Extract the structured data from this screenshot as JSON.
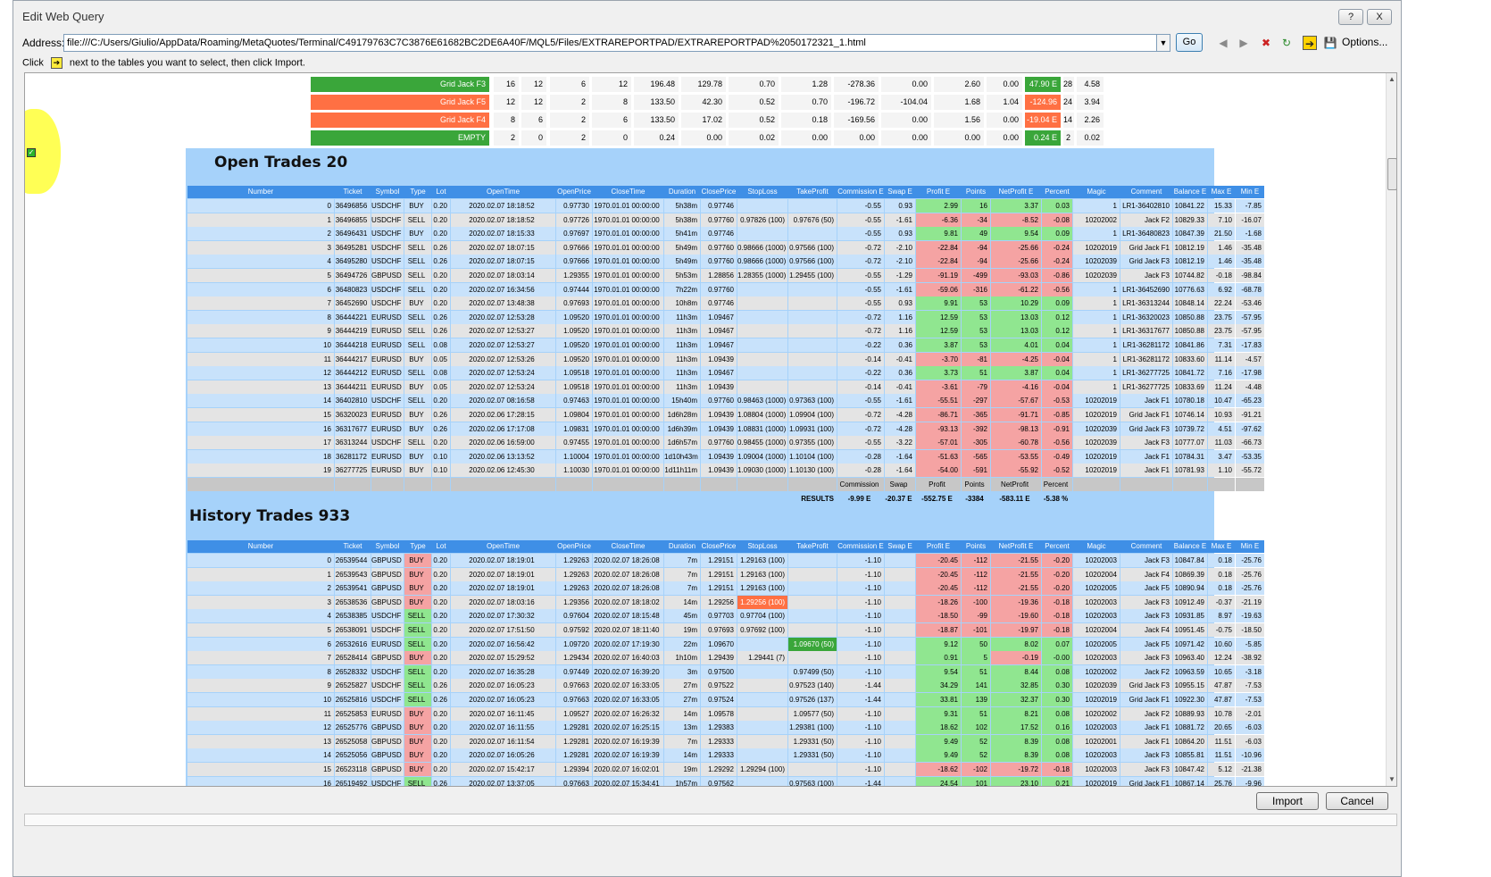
{
  "window": {
    "title": "Edit Web Query",
    "help": "?",
    "close": "X"
  },
  "address": {
    "label": "Address:",
    "value": "file:///C:/Users/Giulio/AppData/Roaming/MetaQuotes/Terminal/C49179763C7C3876E61682BC2DE6A40F/MQL5/Files/EXTRAREPORTPAD/EXTRAREPORTPAD%2050172321_1.html",
    "go": "Go",
    "options": "Options..."
  },
  "hint": {
    "prefix": "Click",
    "suffix": "next to the tables you want to select, then click Import."
  },
  "grid_panel": [
    {
      "name": "Grid Jack F3",
      "color": "#3aa63a",
      "vals": [
        "16",
        "12",
        "6",
        "12",
        "196.48",
        "129.78",
        "0.70",
        "1.28",
        "-278.36",
        "0.00",
        "2.60",
        "0.00",
        "47.90 E",
        "28",
        "4.58"
      ],
      "hl": "g"
    },
    {
      "name": "Grid Jack F5",
      "color": "#ff7043",
      "vals": [
        "12",
        "12",
        "2",
        "8",
        "133.50",
        "42.30",
        "0.52",
        "0.70",
        "-196.72",
        "-104.04",
        "1.68",
        "1.04",
        "-124.96 E",
        "24",
        "3.94"
      ],
      "hl": "r"
    },
    {
      "name": "Grid Jack F4",
      "color": "#ff7043",
      "vals": [
        "8",
        "6",
        "2",
        "6",
        "133.50",
        "17.02",
        "0.52",
        "0.18",
        "-169.56",
        "0.00",
        "1.56",
        "0.00",
        "-19.04 E",
        "14",
        "2.26"
      ],
      "hl": "r"
    },
    {
      "name": "EMPTY",
      "color": "#3aa63a",
      "vals": [
        "2",
        "0",
        "2",
        "0",
        "0.24",
        "0.00",
        "0.02",
        "0.00",
        "0.00",
        "0.00",
        "0.00",
        "0.00",
        "0.24 E",
        "2",
        "0.02"
      ],
      "hl": "g"
    }
  ],
  "open_trades": {
    "title": "Open Trades 20",
    "headers": [
      "Number",
      "Ticket",
      "Symbol",
      "Type",
      "Lot",
      "OpenTime",
      "OpenPrice",
      "CloseTime",
      "Duration",
      "ClosePrice",
      "StopLoss",
      "TakeProfit",
      "Commission E",
      "Swap E",
      "Profit E",
      "Points",
      "NetProfit E",
      "Percent",
      "Magic",
      "Comment",
      "Balance E",
      "Max E",
      "Min E"
    ],
    "rows": [
      [
        "0",
        "36496856",
        "USDCHF",
        "BUY",
        "0.20",
        "2020.02.07 18:18:52",
        "0.97730",
        "1970.01.01 00:00:00",
        "5h38m",
        "0.97746",
        "",
        "",
        "-0.55",
        "0.93",
        "2.99",
        "16",
        "3.37",
        "0.03",
        "1",
        "LR1-36402810",
        "10841.22",
        "15.33",
        "-7.85"
      ],
      [
        "1",
        "36496855",
        "USDCHF",
        "SELL",
        "0.20",
        "2020.02.07 18:18:52",
        "0.97726",
        "1970.01.01 00:00:00",
        "5h38m",
        "0.97760",
        "0.97826 (100)",
        "0.97676 (50)",
        "-0.55",
        "-1.61",
        "-6.36",
        "-34",
        "-8.52",
        "-0.08",
        "10202002",
        "Jack F2",
        "10829.33",
        "7.10",
        "-16.07"
      ],
      [
        "2",
        "36496431",
        "USDCHF",
        "BUY",
        "0.20",
        "2020.02.07 18:15:33",
        "0.97697",
        "1970.01.01 00:00:00",
        "5h41m",
        "0.97746",
        "",
        "",
        "-0.55",
        "0.93",
        "9.81",
        "49",
        "9.54",
        "0.09",
        "1",
        "LR1-36480823",
        "10847.39",
        "21.50",
        "-1.68"
      ],
      [
        "3",
        "36495281",
        "USDCHF",
        "SELL",
        "0.26",
        "2020.02.07 18:07:15",
        "0.97666",
        "1970.01.01 00:00:00",
        "5h49m",
        "0.97760",
        "0.98666 (1000)",
        "0.97566 (100)",
        "-0.72",
        "-2.10",
        "-22.84",
        "-94",
        "-25.66",
        "-0.24",
        "10202019",
        "Grid Jack F1",
        "10812.19",
        "1.46",
        "-35.48"
      ],
      [
        "4",
        "36495280",
        "USDCHF",
        "SELL",
        "0.26",
        "2020.02.07 18:07:15",
        "0.97666",
        "1970.01.01 00:00:00",
        "5h49m",
        "0.97760",
        "0.98666 (1000)",
        "0.97566 (100)",
        "-0.72",
        "-2.10",
        "-22.84",
        "-94",
        "-25.66",
        "-0.24",
        "10202039",
        "Grid Jack F3",
        "10812.19",
        "1.46",
        "-35.48"
      ],
      [
        "5",
        "36494726",
        "GBPUSD",
        "SELL",
        "0.20",
        "2020.02.07 18:03:14",
        "1.29355",
        "1970.01.01 00:00:00",
        "5h53m",
        "1.28856",
        "1.28355 (1000)",
        "1.29455 (100)",
        "-0.55",
        "-1.29",
        "-91.19",
        "-499",
        "-93.03",
        "-0.86",
        "10202039",
        "Jack F3",
        "10744.82",
        "-0.18",
        "-98.84"
      ],
      [
        "6",
        "36480823",
        "USDCHF",
        "SELL",
        "0.20",
        "2020.02.07 16:34:56",
        "0.97444",
        "1970.01.01 00:00:00",
        "7h22m",
        "0.97760",
        "",
        "",
        "-0.55",
        "-1.61",
        "-59.06",
        "-316",
        "-61.22",
        "-0.56",
        "1",
        "LR1-36452690",
        "10776.63",
        "6.92",
        "-68.78"
      ],
      [
        "7",
        "36452690",
        "USDCHF",
        "BUY",
        "0.20",
        "2020.02.07 13:48:38",
        "0.97693",
        "1970.01.01 00:00:00",
        "10h8m",
        "0.97746",
        "",
        "",
        "-0.55",
        "0.93",
        "9.91",
        "53",
        "10.29",
        "0.09",
        "1",
        "LR1-36313244",
        "10848.14",
        "22.24",
        "-53.46"
      ],
      [
        "8",
        "36444221",
        "EURUSD",
        "SELL",
        "0.26",
        "2020.02.07 12:53:28",
        "1.09520",
        "1970.01.01 00:00:00",
        "11h3m",
        "1.09467",
        "",
        "",
        "-0.72",
        "1.16",
        "12.59",
        "53",
        "13.03",
        "0.12",
        "1",
        "LR1-36320023",
        "10850.88",
        "23.75",
        "-57.95"
      ],
      [
        "9",
        "36444219",
        "EURUSD",
        "SELL",
        "0.26",
        "2020.02.07 12:53:27",
        "1.09520",
        "1970.01.01 00:00:00",
        "11h3m",
        "1.09467",
        "",
        "",
        "-0.72",
        "1.16",
        "12.59",
        "53",
        "13.03",
        "0.12",
        "1",
        "LR1-36317677",
        "10850.88",
        "23.75",
        "-57.95"
      ],
      [
        "10",
        "36444218",
        "EURUSD",
        "SELL",
        "0.08",
        "2020.02.07 12:53:27",
        "1.09520",
        "1970.01.01 00:00:00",
        "11h3m",
        "1.09467",
        "",
        "",
        "-0.22",
        "0.36",
        "3.87",
        "53",
        "4.01",
        "0.04",
        "1",
        "LR1-36281172",
        "10841.86",
        "7.31",
        "-17.83"
      ],
      [
        "11",
        "36444217",
        "EURUSD",
        "BUY",
        "0.05",
        "2020.02.07 12:53:26",
        "1.09520",
        "1970.01.01 00:00:00",
        "11h3m",
        "1.09439",
        "",
        "",
        "-0.14",
        "-0.41",
        "-3.70",
        "-81",
        "-4.25",
        "-0.04",
        "1",
        "LR1-36281172",
        "10833.60",
        "11.14",
        "-4.57"
      ],
      [
        "12",
        "36444212",
        "EURUSD",
        "SELL",
        "0.08",
        "2020.02.07 12:53:24",
        "1.09518",
        "1970.01.01 00:00:00",
        "11h3m",
        "1.09467",
        "",
        "",
        "-0.22",
        "0.36",
        "3.73",
        "51",
        "3.87",
        "0.04",
        "1",
        "LR1-36277725",
        "10841.72",
        "7.16",
        "-17.98"
      ],
      [
        "13",
        "36444211",
        "EURUSD",
        "BUY",
        "0.05",
        "2020.02.07 12:53:24",
        "1.09518",
        "1970.01.01 00:00:00",
        "11h3m",
        "1.09439",
        "",
        "",
        "-0.14",
        "-0.41",
        "-3.61",
        "-79",
        "-4.16",
        "-0.04",
        "1",
        "LR1-36277725",
        "10833.69",
        "11.24",
        "-4.48"
      ],
      [
        "14",
        "36402810",
        "USDCHF",
        "SELL",
        "0.20",
        "2020.02.07 08:16:58",
        "0.97463",
        "1970.01.01 00:00:00",
        "15h40m",
        "0.97760",
        "0.98463 (1000)",
        "0.97363 (100)",
        "-0.55",
        "-1.61",
        "-55.51",
        "-297",
        "-57.67",
        "-0.53",
        "10202019",
        "Jack F1",
        "10780.18",
        "10.47",
        "-65.23"
      ],
      [
        "15",
        "36320023",
        "EURUSD",
        "BUY",
        "0.26",
        "2020.02.06 17:28:15",
        "1.09804",
        "1970.01.01 00:00:00",
        "1d6h28m",
        "1.09439",
        "1.08804 (1000)",
        "1.09904 (100)",
        "-0.72",
        "-4.28",
        "-86.71",
        "-365",
        "-91.71",
        "-0.85",
        "10202019",
        "Grid Jack F1",
        "10746.14",
        "10.93",
        "-91.21"
      ],
      [
        "16",
        "36317677",
        "EURUSD",
        "BUY",
        "0.26",
        "2020.02.06 17:17:08",
        "1.09831",
        "1970.01.01 00:00:00",
        "1d6h39m",
        "1.09439",
        "1.08831 (1000)",
        "1.09931 (100)",
        "-0.72",
        "-4.28",
        "-93.13",
        "-392",
        "-98.13",
        "-0.91",
        "10202039",
        "Grid Jack F3",
        "10739.72",
        "4.51",
        "-97.62"
      ],
      [
        "17",
        "36313244",
        "USDCHF",
        "SELL",
        "0.20",
        "2020.02.06 16:59:00",
        "0.97455",
        "1970.01.01 00:00:00",
        "1d6h57m",
        "0.97760",
        "0.98455 (1000)",
        "0.97355 (100)",
        "-0.55",
        "-3.22",
        "-57.01",
        "-305",
        "-60.78",
        "-0.56",
        "10202039",
        "Jack F3",
        "10777.07",
        "11.03",
        "-66.73"
      ],
      [
        "18",
        "36281172",
        "EURUSD",
        "BUY",
        "0.10",
        "2020.02.06 13:13:52",
        "1.10004",
        "1970.01.01 00:00:00",
        "1d10h43m",
        "1.09439",
        "1.09004 (1000)",
        "1.10104 (100)",
        "-0.28",
        "-1.64",
        "-51.63",
        "-565",
        "-53.55",
        "-0.49",
        "10202019",
        "Jack F1",
        "10784.31",
        "3.47",
        "-53.35"
      ],
      [
        "19",
        "36277725",
        "EURUSD",
        "BUY",
        "0.10",
        "2020.02.06 12:45:30",
        "1.10030",
        "1970.01.01 00:00:00",
        "1d11h11m",
        "1.09439",
        "1.09030 (1000)",
        "1.10130 (100)",
        "-0.28",
        "-1.64",
        "-54.00",
        "-591",
        "-55.92",
        "-0.52",
        "10202019",
        "Jack F1",
        "10781.93",
        "1.10",
        "-55.72"
      ]
    ],
    "totals_labels": [
      "Commission",
      "Swap",
      "Profit",
      "Points",
      "NetProfit",
      "Percent"
    ],
    "results_label": "RESULTS",
    "results": [
      "-9.99 E",
      "-20.37 E",
      "-552.75 E",
      "-3384",
      "-583.11 E",
      "-5.38 %"
    ]
  },
  "history_trades": {
    "title": "History Trades 933",
    "headers": [
      "Number",
      "Ticket",
      "Symbol",
      "Type",
      "Lot",
      "OpenTime",
      "OpenPrice",
      "CloseTime",
      "Duration",
      "ClosePrice",
      "StopLoss",
      "TakeProfit",
      "Commission E",
      "Swap E",
      "Profit E",
      "Points",
      "NetProfit E",
      "Percent",
      "Magic",
      "Comment",
      "Balance E",
      "Max E",
      "Min E"
    ],
    "rows": [
      [
        "0",
        "26539544",
        "GBPUSD",
        "BUY",
        "0.20",
        "2020.02.07 18:19:01",
        "1.29263",
        "2020.02.07 18:26:08",
        "7m",
        "1.29151",
        "1.29163 (100)",
        "",
        "-1.10",
        "",
        "-20.45",
        "-112",
        "-21.55",
        "-0.20",
        "10202003",
        "Jack F3",
        "10847.84",
        "0.18",
        "-25.76"
      ],
      [
        "1",
        "26539543",
        "GBPUSD",
        "BUY",
        "0.20",
        "2020.02.07 18:19:01",
        "1.29263",
        "2020.02.07 18:26:08",
        "7m",
        "1.29151",
        "1.29163 (100)",
        "",
        "-1.10",
        "",
        "-20.45",
        "-112",
        "-21.55",
        "-0.20",
        "10202004",
        "Jack F4",
        "10869.39",
        "0.18",
        "-25.76"
      ],
      [
        "2",
        "26539541",
        "GBPUSD",
        "BUY",
        "0.20",
        "2020.02.07 18:19:01",
        "1.29263",
        "2020.02.07 18:26:08",
        "7m",
        "1.29151",
        "1.29163 (100)",
        "",
        "-1.10",
        "",
        "-20.45",
        "-112",
        "-21.55",
        "-0.20",
        "10202005",
        "Jack F5",
        "10890.94",
        "0.18",
        "-25.76"
      ],
      [
        "3",
        "26538536",
        "GBPUSD",
        "BUY",
        "0.20",
        "2020.02.07 18:03:16",
        "1.29356",
        "2020.02.07 18:18:02",
        "14m",
        "1.29256",
        "1.29256 (100)",
        "",
        "-1.10",
        "",
        "-18.26",
        "-100",
        "-19.36",
        "-0.18",
        "10202003",
        "Jack F3",
        "10912.49",
        "-0.37",
        "-21.19"
      ],
      [
        "4",
        "26538385",
        "USDCHF",
        "SELL",
        "0.20",
        "2020.02.07 17:30:32",
        "0.97604",
        "2020.02.07 18:15:48",
        "45m",
        "0.97703",
        "0.97704 (100)",
        "",
        "-1.10",
        "",
        "-18.50",
        "-99",
        "-19.60",
        "-0.18",
        "10202003",
        "Jack F3",
        "10931.85",
        "8.97",
        "-19.63"
      ],
      [
        "5",
        "26538091",
        "USDCHF",
        "SELL",
        "0.20",
        "2020.02.07 17:51:50",
        "0.97592",
        "2020.02.07 18:11:40",
        "19m",
        "0.97693",
        "0.97692 (100)",
        "",
        "-1.10",
        "",
        "-18.87",
        "-101",
        "-19.97",
        "-0.18",
        "10202004",
        "Jack F4",
        "10951.45",
        "-0.75",
        "-18.50"
      ],
      [
        "6",
        "26532616",
        "EURUSD",
        "SELL",
        "0.20",
        "2020.02.07 16:56:42",
        "1.09720",
        "2020.02.07 17:19:30",
        "22m",
        "1.09670",
        "",
        "1.09670 (50)",
        "-1.10",
        "",
        "9.12",
        "50",
        "8.02",
        "0.07",
        "10202005",
        "Jack F5",
        "10971.42",
        "10.60",
        "-5.85"
      ],
      [
        "7",
        "26528414",
        "GBPUSD",
        "BUY",
        "0.20",
        "2020.02.07 15:29:52",
        "1.29434",
        "2020.02.07 16:40:03",
        "1h10m",
        "1.29439",
        "1.29441 (7)",
        "",
        "-1.10",
        "",
        "0.91",
        "5",
        "-0.19",
        "-0.00",
        "10202003",
        "Jack F3",
        "10963.40",
        "12.24",
        "-38.92"
      ],
      [
        "8",
        "26528332",
        "USDCHF",
        "SELL",
        "0.20",
        "2020.02.07 16:35:28",
        "0.97449",
        "2020.02.07 16:39:20",
        "3m",
        "0.97500",
        "",
        "0.97499 (50)",
        "-1.10",
        "",
        "9.54",
        "51",
        "8.44",
        "0.08",
        "10202002",
        "Jack F2",
        "10963.59",
        "10.65",
        "-3.18"
      ],
      [
        "9",
        "26525827",
        "USDCHF",
        "SELL",
        "0.26",
        "2020.02.07 16:05:23",
        "0.97663",
        "2020.02.07 16:33:05",
        "27m",
        "0.97522",
        "",
        "0.97523 (140)",
        "-1.44",
        "",
        "34.29",
        "141",
        "32.85",
        "0.30",
        "10202039",
        "Grid Jack F3",
        "10955.15",
        "47.87",
        "-7.53"
      ],
      [
        "10",
        "26525816",
        "USDCHF",
        "SELL",
        "0.26",
        "2020.02.07 16:05:23",
        "0.97663",
        "2020.02.07 16:33:05",
        "27m",
        "0.97524",
        "",
        "0.97526 (137)",
        "-1.44",
        "",
        "33.81",
        "139",
        "32.37",
        "0.30",
        "10202019",
        "Grid Jack F1",
        "10922.30",
        "47.87",
        "-7.53"
      ],
      [
        "11",
        "26525853",
        "EURUSD",
        "BUY",
        "0.20",
        "2020.02.07 16:11:45",
        "1.09527",
        "2020.02.07 16:26:32",
        "14m",
        "1.09578",
        "",
        "1.09577 (50)",
        "-1.10",
        "",
        "9.31",
        "51",
        "8.21",
        "0.08",
        "10202002",
        "Jack F2",
        "10889.93",
        "10.78",
        "-2.01"
      ],
      [
        "12",
        "26525776",
        "GBPUSD",
        "BUY",
        "0.20",
        "2020.02.07 16:11:55",
        "1.29281",
        "2020.02.07 16:25:15",
        "13m",
        "1.29383",
        "",
        "1.29381 (100)",
        "-1.10",
        "",
        "18.62",
        "102",
        "17.52",
        "0.16",
        "10202003",
        "Jack F1",
        "10881.72",
        "20.65",
        "-6.03"
      ],
      [
        "13",
        "26525058",
        "GBPUSD",
        "BUY",
        "0.20",
        "2020.02.07 16:11:54",
        "1.29281",
        "2020.02.07 16:19:39",
        "7m",
        "1.29333",
        "",
        "1.29331 (50)",
        "-1.10",
        "",
        "9.49",
        "52",
        "8.39",
        "0.08",
        "10202001",
        "Jack F1",
        "10864.20",
        "11.51",
        "-6.03"
      ],
      [
        "14",
        "26525056",
        "GBPUSD",
        "BUY",
        "0.20",
        "2020.02.07 16:05:26",
        "1.29281",
        "2020.02.07 16:19:39",
        "14m",
        "1.29333",
        "",
        "1.29331 (50)",
        "-1.10",
        "",
        "9.49",
        "52",
        "8.39",
        "0.08",
        "10202003",
        "Jack F3",
        "10855.81",
        "11.51",
        "-10.96"
      ],
      [
        "15",
        "26523118",
        "GBPUSD",
        "BUY",
        "0.20",
        "2020.02.07 15:42:17",
        "1.29394",
        "2020.02.07 16:02:01",
        "19m",
        "1.29292",
        "1.29294 (100)",
        "",
        "-1.10",
        "",
        "-18.62",
        "-102",
        "-19.72",
        "-0.18",
        "10202003",
        "Jack F3",
        "10847.42",
        "5.12",
        "-21.38"
      ],
      [
        "16",
        "26519492",
        "USDCHF",
        "SELL",
        "0.26",
        "2020.02.07 13:37:05",
        "0.97663",
        "2020.02.07 15:34:41",
        "1h57m",
        "0.97562",
        "",
        "0.97563 (100)",
        "-1.44",
        "",
        "24.54",
        "101",
        "23.10",
        "0.21",
        "10202019",
        "Grid Jack F1",
        "10867.14",
        "25.76",
        "-9.96"
      ]
    ]
  },
  "buttons": {
    "import": "Import",
    "cancel": "Cancel"
  }
}
